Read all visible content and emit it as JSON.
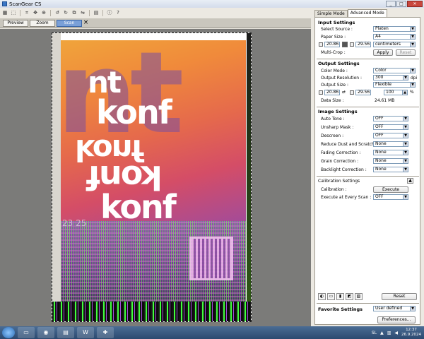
{
  "window": {
    "title": "ScanGear CS"
  },
  "toolbar": {
    "icons": [
      "thumbnail-icon",
      "select-icon",
      "crop-icon",
      "move-icon",
      "zoom-icon",
      "rotate-left-icon",
      "rotate-right-icon",
      "auto-crop-icon",
      "mirror-icon",
      "grid-icon",
      "info-icon",
      "help-icon"
    ]
  },
  "view_tabs": {
    "preview": "Preview",
    "zoom": "Zoom",
    "scan": "Scan",
    "close": "×"
  },
  "mode_tabs": {
    "simple": "Simple Mode",
    "advanced": "Advanced Mode"
  },
  "input_settings": {
    "title": "Input Settings",
    "select_source_label": "Select Source :",
    "select_source_value": "Platen",
    "paper_size_label": "Paper Size :",
    "paper_size_value": "A4",
    "width": "20.86",
    "height": "29.56",
    "unit": "centimeters",
    "multi_crop_label": "Multi-Crop :",
    "apply": "Apply",
    "reset": "Reset"
  },
  "output_settings": {
    "title": "Output Settings",
    "color_mode_label": "Color Mode :",
    "color_mode_value": "Color",
    "resolution_label": "Output Resolution :",
    "resolution_value": "300",
    "resolution_unit": "dpi",
    "output_size_label": "Output Size :",
    "output_size_value": "Flexible",
    "width": "20.86",
    "height": "29.56",
    "scale": "100",
    "scale_unit": "%",
    "data_size_label": "Data Size :",
    "data_size_value": "24.61 MB"
  },
  "image_settings": {
    "title": "Image Settings",
    "rows": [
      {
        "label": "Auto Tone :",
        "value": "OFF"
      },
      {
        "label": "Unsharp Mask :",
        "value": "OFF"
      },
      {
        "label": "Descreen :",
        "value": "OFF"
      },
      {
        "label": "Reduce Dust and Scratches :",
        "value": "None"
      },
      {
        "label": "Fading Correction :",
        "value": "None"
      },
      {
        "label": "Grain Correction :",
        "value": "None"
      },
      {
        "label": "Backlight Correction :",
        "value": "None"
      }
    ]
  },
  "calibration": {
    "title": "Calibration Settings",
    "calibration_label": "Calibration :",
    "execute": "Execute",
    "every_scan_label": "Execute at Every Scan :",
    "every_scan_value": "OFF"
  },
  "bottom_tools": {
    "reset": "Reset"
  },
  "favorite": {
    "label": "Favorite Settings",
    "value": "User defined"
  },
  "preferences": "Preferences...",
  "poster": {
    "line1": "nt",
    "line2": "konf",
    "line3": "konf",
    "line4": "konf",
    "line5": "konf",
    "dates": "23  25"
  },
  "taskbar": {
    "lang": "SL",
    "time": "12:37",
    "date": "26.9.2024"
  }
}
